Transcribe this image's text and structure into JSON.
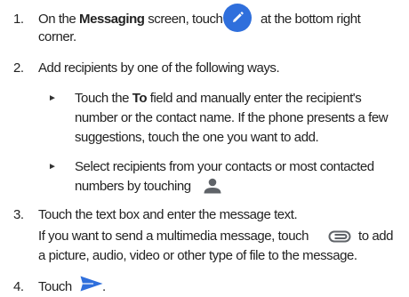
{
  "steps": [
    {
      "number": "1.",
      "line1_pre": "On the ",
      "line1_bold": "Messaging",
      "line1_mid": " screen, touch",
      "line1_post": "at the bottom right",
      "line2": "corner."
    },
    {
      "number": "2.",
      "text": "Add recipients by one of the following ways.",
      "bullets": [
        {
          "marker": "►",
          "line1_pre": "Touch the ",
          "line1_bold": "To",
          "line1_post": " field and manually enter the recipient's",
          "line2": "number or the contact name. If the phone presents a few",
          "line3": "suggestions, touch the one you want to add."
        },
        {
          "marker": "►",
          "line1": "Select recipients from your contacts or most contacted",
          "line2": "numbers by touching"
        }
      ]
    },
    {
      "number": "3.",
      "line1": "Touch the text box and enter the message text.",
      "line2_pre": "If you want to send a multimedia message, touch",
      "line2_post": "to add",
      "line3": "a picture, audio, video or other type of file to the message."
    },
    {
      "number": "4.",
      "text": "Touch",
      "end": "."
    }
  ],
  "icons": {
    "compose": "compose-pencil-icon",
    "contact": "person-icon",
    "attach": "paperclip-attach-icon",
    "send": "send-arrow-icon"
  },
  "colors": {
    "accent": "#2f6fdc",
    "text": "#222222",
    "icon_gray": "#5f6368"
  }
}
